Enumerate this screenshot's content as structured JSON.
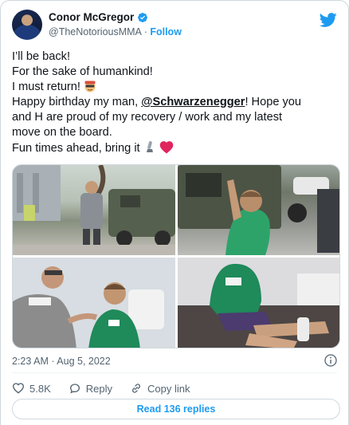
{
  "author": {
    "name": "Conor McGregor",
    "handle": "@TheNotoriousMMA",
    "separator": "·",
    "follow_label": "Follow"
  },
  "tweet": {
    "lines": [
      "I’ll be back!",
      "For the sake of humankind!",
      "I must return!",
      "Happy birthday my man, ",
      "and H are proud of my recovery / work and my latest",
      "move on the board.",
      "Fun times ahead, bring it"
    ],
    "mention": "@Schwarzenegger",
    "after_mention": "! Hope you"
  },
  "meta": {
    "time": "2:23 AM · Aug 5, 2022"
  },
  "actions": {
    "likes": "5.8K",
    "reply_label": "Reply",
    "copy_link_label": "Copy link"
  },
  "read_replies_label": "Read 136 replies",
  "colors": {
    "accent": "#1d9bf0",
    "text": "#0f1419",
    "muted": "#536471",
    "border": "#cfd9de"
  },
  "icons": [
    "verified-badge-icon",
    "twitter-bird-icon",
    "info-icon",
    "heart-icon",
    "reply-icon",
    "link-icon",
    "cool-emoji-icon",
    "leg-emoji-icon",
    "red-heart-emoji-icon"
  ]
}
